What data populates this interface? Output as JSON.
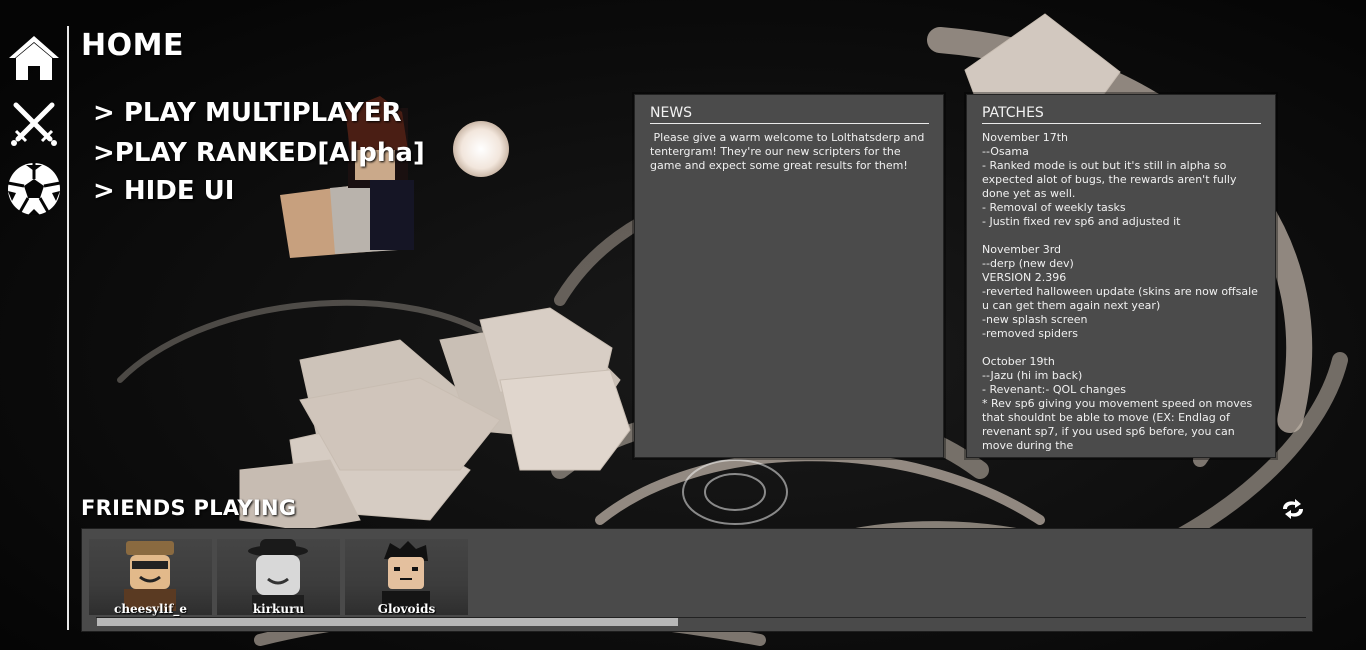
{
  "sidebar": {
    "items": [
      {
        "icon": "home-icon"
      },
      {
        "icon": "crossed-swords-icon"
      },
      {
        "icon": "soccer-ball-icon"
      }
    ]
  },
  "page_title": "HOME",
  "menu": {
    "play_multiplayer": "> PLAY MULTIPLAYER",
    "play_ranked": ">PLAY RANKED[Alpha]",
    "hide_ui": "> HIDE UI"
  },
  "news": {
    "title": "NEWS",
    "body": " Please give a warm welcome to Lolthatsderp and tentergram! They're our new scripters for the game and expect some great results for them!"
  },
  "patches": {
    "title": "PATCHES",
    "body": "November 17th\n--Osama\n- Ranked mode is out but it's still in alpha so expected alot of bugs, the rewards aren't fully done yet as well.\n- Removal of weekly tasks\n- Justin fixed rev sp6 and adjusted it\n\nNovember 3rd\n--derp (new dev)\nVERSION 2.396\n-reverted halloween update (skins are now offsale u can get them again next year)\n-new splash screen\n-removed spiders\n\nOctober 19th\n--Jazu (hi im back)\n- Revenant:- QOL changes\n* Rev sp6 giving you movement speed on moves that shouldnt be able to move (EX: Endlag of revenant sp7, if you used sp6 before, you can move during the"
  },
  "friends": {
    "title": "FRIENDS PLAYING",
    "refresh_icon": "refresh-icon",
    "list": [
      {
        "name": "cheesylif_e"
      },
      {
        "name": "kirkuru"
      },
      {
        "name": "Glovoids"
      }
    ],
    "scroll_fraction": 0.48
  },
  "colors": {
    "panel": "#4b4b4b",
    "accent": "#ffffff"
  }
}
